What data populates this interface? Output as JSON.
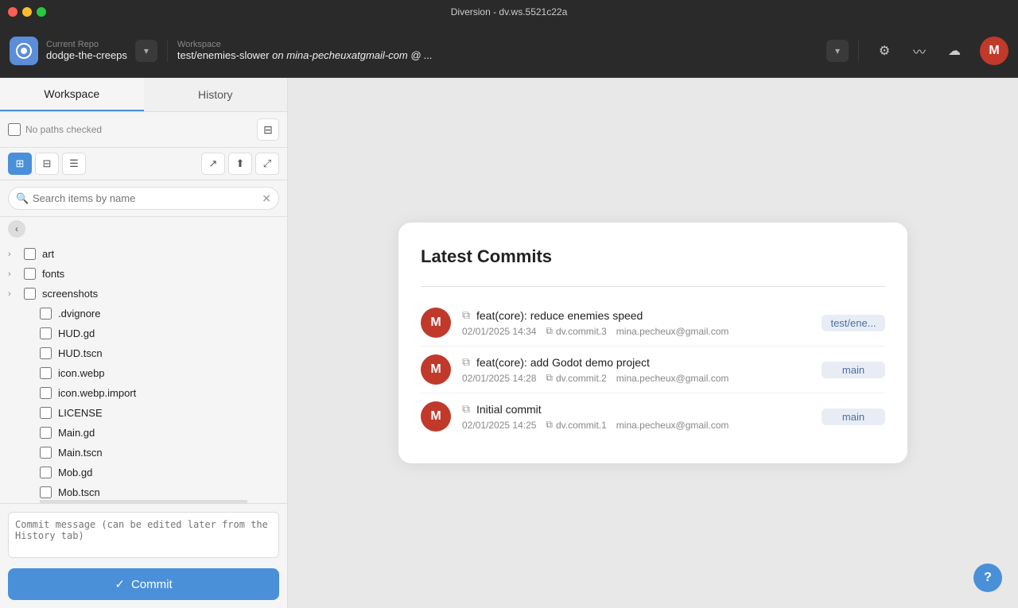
{
  "app": {
    "title": "Diversion - dv.ws.5521c22a"
  },
  "header": {
    "repo_label": "Current Repo",
    "repo_name": "dodge-the-creeps",
    "workspace_label": "Workspace",
    "workspace_name": "test/enemies-slower (on mina-pecheuxatgmail-com @ ...",
    "workspace_name_full": "test/enemies-slower",
    "workspace_italic": "on mina-pecheuxatgmail-com @ ...",
    "avatar_initial": "M"
  },
  "sidebar": {
    "tab_workspace": "Workspace",
    "tab_history": "History",
    "no_paths_checked": "No paths checked",
    "search_placeholder": "Search items by name",
    "commit_placeholder": "Commit message (can be edited later from the History tab)",
    "commit_label": "Commit",
    "files": [
      {
        "name": "art",
        "type": "folder",
        "indent": 0
      },
      {
        "name": "fonts",
        "type": "folder",
        "indent": 0
      },
      {
        "name": "screenshots",
        "type": "folder",
        "indent": 0
      },
      {
        "name": ".dvignore",
        "type": "file",
        "indent": 1
      },
      {
        "name": "HUD.gd",
        "type": "file",
        "indent": 1
      },
      {
        "name": "HUD.tscn",
        "type": "file",
        "indent": 1
      },
      {
        "name": "icon.webp",
        "type": "file",
        "indent": 1
      },
      {
        "name": "icon.webp.import",
        "type": "file",
        "indent": 1
      },
      {
        "name": "LICENSE",
        "type": "file",
        "indent": 1
      },
      {
        "name": "Main.gd",
        "type": "file",
        "indent": 1
      },
      {
        "name": "Main.tscn",
        "type": "file",
        "indent": 1
      },
      {
        "name": "Mob.gd",
        "type": "file",
        "indent": 1
      },
      {
        "name": "Mob.tscn",
        "type": "file",
        "indent": 1
      }
    ]
  },
  "commits_panel": {
    "title": "Latest Commits",
    "commits": [
      {
        "avatar": "M",
        "message": "feat(core): reduce enemies speed",
        "date": "02/01/2025 14:34",
        "hash": "dv.commit.3",
        "email": "mina.pecheux@gmail.com",
        "branch": "test/ene..."
      },
      {
        "avatar": "M",
        "message": "feat(core): add Godot demo project",
        "date": "02/01/2025 14:28",
        "hash": "dv.commit.2",
        "email": "mina.pecheux@gmail.com",
        "branch": "main"
      },
      {
        "avatar": "M",
        "message": "Initial commit",
        "date": "02/01/2025 14:25",
        "hash": "dv.commit.1",
        "email": "mina.pecheux@gmail.com",
        "branch": "main"
      }
    ]
  },
  "icons": {
    "gear": "⚙",
    "chart": "〰",
    "cloud": "☁",
    "chevron_down": "▾",
    "chevron_right": "›",
    "search": "🔍",
    "clear": "✕",
    "tree_view": "⊞",
    "split_view": "⊟",
    "list_view": "☰",
    "open_file": "↗",
    "upload": "⬆",
    "expand": "⤢",
    "back": "‹",
    "copy": "⧉",
    "commit_check": "✓",
    "help": "?"
  },
  "colors": {
    "accent": "#4a90d9",
    "avatar_red": "#c0392b",
    "branch_bg": "#e8edf5",
    "branch_text": "#4a6fa5"
  }
}
